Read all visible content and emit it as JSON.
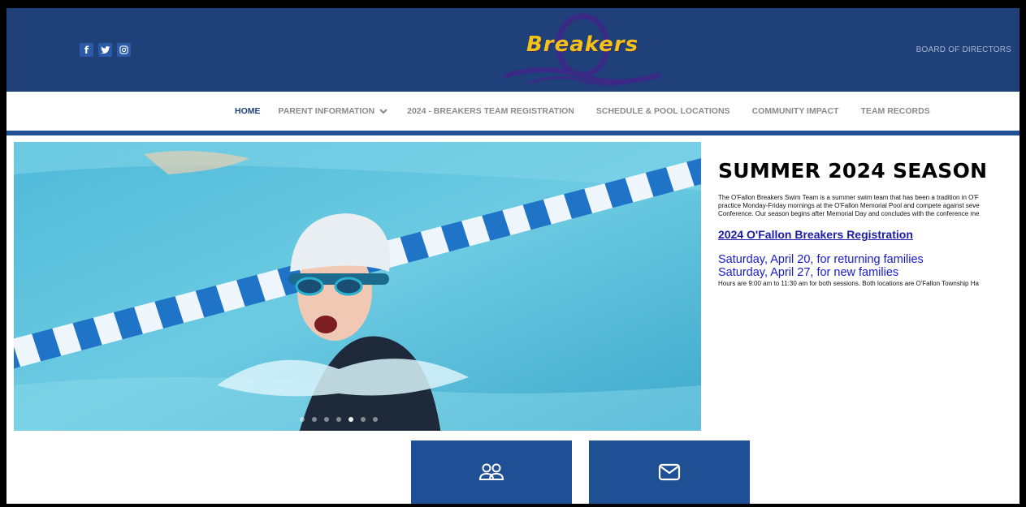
{
  "header": {
    "logo_text": "Breakers",
    "board_link": "BOARD OF DIRECTORS",
    "social": [
      {
        "icon": "facebook-icon",
        "glyph": "f"
      },
      {
        "icon": "twitter-icon"
      },
      {
        "icon": "instagram-icon"
      }
    ]
  },
  "nav": {
    "items": [
      {
        "label": "HOME",
        "active": true
      },
      {
        "label": "PARENT INFORMATION",
        "has_dropdown": true
      },
      {
        "label": "2024 - BREAKERS TEAM REGISTRATION"
      },
      {
        "label": "SCHEDULE & POOL LOCATIONS"
      },
      {
        "label": "COMMUNITY IMPACT"
      },
      {
        "label": "TEAM RECORDS"
      }
    ],
    "dropdown_glyph": "⌄"
  },
  "hero": {
    "slide_count": 7,
    "active_slide": 5
  },
  "content": {
    "title": "SUMMER 2024 SEASON",
    "paragraph_lines": [
      "The O'Fallon Breakers Swim Team is a summer swim team that has been a tradition in O'F",
      "practice Monday-Friday mornings at the O'Fallon Memorial Pool and compete against seve",
      "Conference. Our season begins after Memorial Day and concludes with the conference me"
    ],
    "registration_link": "2024 O'Fallon Breakers Registration",
    "dates": [
      "Saturday, April 20, for returning families",
      "Saturday, April 27, for new families"
    ],
    "hours": "Hours are 9:00 am to 11:30 am for both sessions. Both locations are O'Fallon Township Ha"
  },
  "tiles": [
    {
      "icon": "people-icon"
    },
    {
      "icon": "mail-icon"
    }
  ],
  "colors": {
    "header_bg": "#1f4079",
    "accent_blue": "#1f4f94",
    "logo_yellow": "#f2c316",
    "link_blue": "#1b1ba8"
  }
}
